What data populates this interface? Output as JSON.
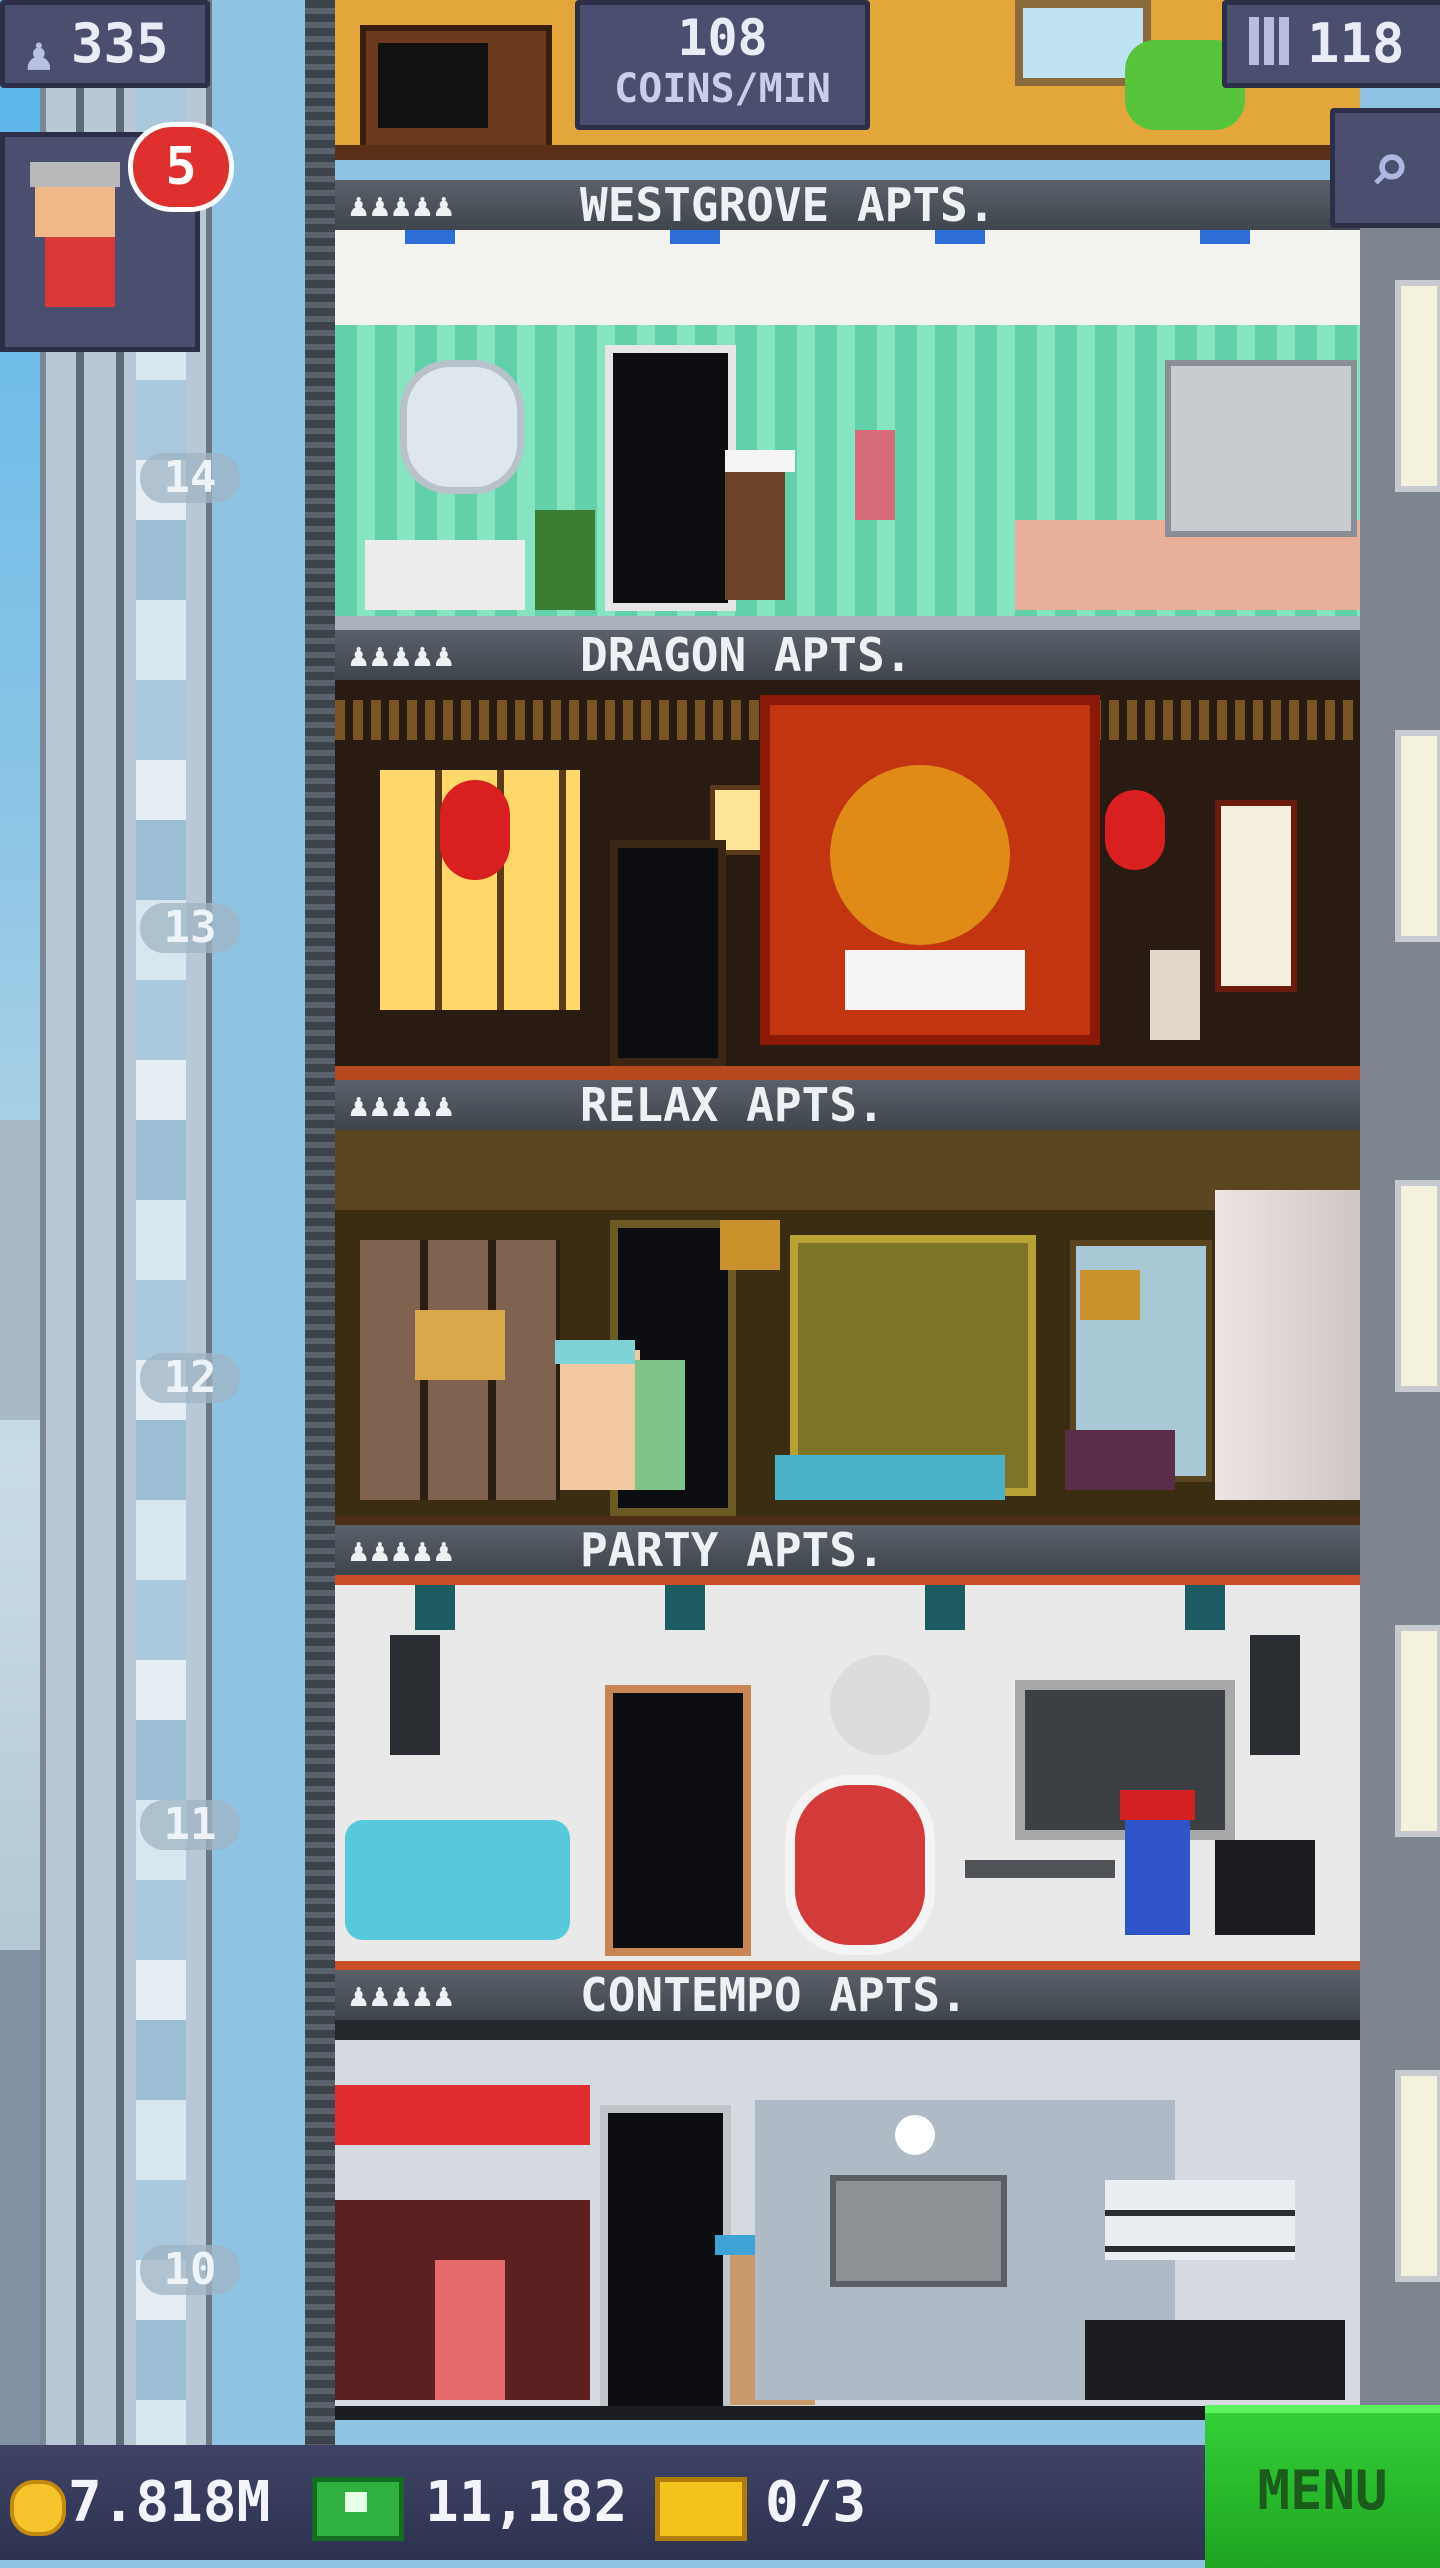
{
  "hud": {
    "population": "335",
    "coins_per_min_value": "108",
    "coins_per_min_unit": "COINS/MIN",
    "floors": "118",
    "visitor_badge": "5"
  },
  "floors": [
    {
      "label": "WESTGROVE APTS.",
      "people": "♟♟♟♟♟",
      "number": "14",
      "theme": "mint"
    },
    {
      "label": "DRAGON APTS.",
      "people": "♟♟♟♟♟",
      "number": "13",
      "theme": "dragon"
    },
    {
      "label": "RELAX APTS.",
      "people": "♟♟♟♟♟",
      "number": "12",
      "theme": "relax"
    },
    {
      "label": "PARTY APTS.",
      "people": "♟♟♟♟♟",
      "number": "11",
      "theme": "party"
    },
    {
      "label": "CONTEMPO APTS.",
      "people": "♟♟♟♟♟",
      "number": "10",
      "theme": "contempo"
    }
  ],
  "bottom_bar": {
    "coins": "7.818M",
    "bux": "11,182",
    "tickets": "0/3",
    "menu_label": "MENU"
  },
  "colors": {
    "hud_bg": "#4a4f70",
    "menu_green": "#26b82a",
    "badge_red": "#e02f2f",
    "label_bar": "#4c525a"
  }
}
